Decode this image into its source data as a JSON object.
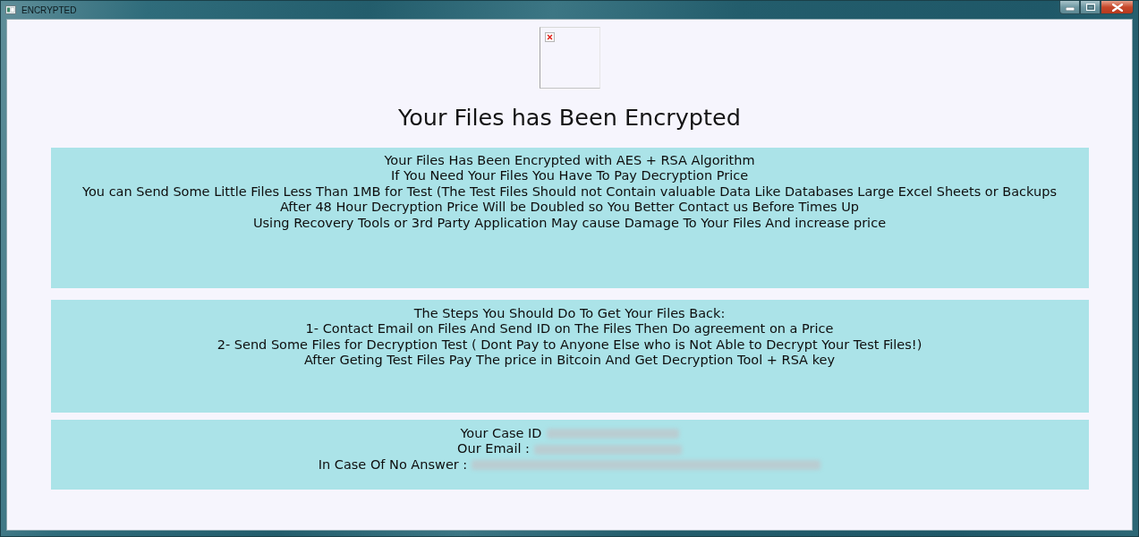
{
  "window": {
    "title": "ENCRYPTED"
  },
  "heading": "Your Files has Been Encrypted",
  "notice": {
    "lines": [
      "Your Files Has Been Encrypted with AES + RSA Algorithm",
      "If You Need Your Files You Have To Pay Decryption Price",
      "You can Send Some Little Files Less Than 1MB for Test (The Test Files Should not Contain valuable Data Like Databases Large Excel Sheets or Backups",
      "After 48 Hour Decryption Price Will be Doubled so You Better Contact us Before Times Up",
      "Using Recovery Tools or 3rd Party Application May cause Damage To Your Files And increase price"
    ]
  },
  "steps": {
    "lines": [
      "The Steps You Should Do To Get Your Files Back:",
      "1- Contact Email on Files And Send ID on The Files Then Do agreement on a Price",
      "2- Send Some Files for Decryption Test ( Dont Pay to Anyone Else who is Not Able to Decrypt Your Test Files!)",
      "After Geting Test Files Pay The price in Bitcoin And Get Decryption Tool + RSA key"
    ]
  },
  "contact": {
    "rows": [
      {
        "label": "Your Case ID"
      },
      {
        "label": "Our Email :"
      },
      {
        "label": "In Case Of No Answer :"
      }
    ]
  }
}
